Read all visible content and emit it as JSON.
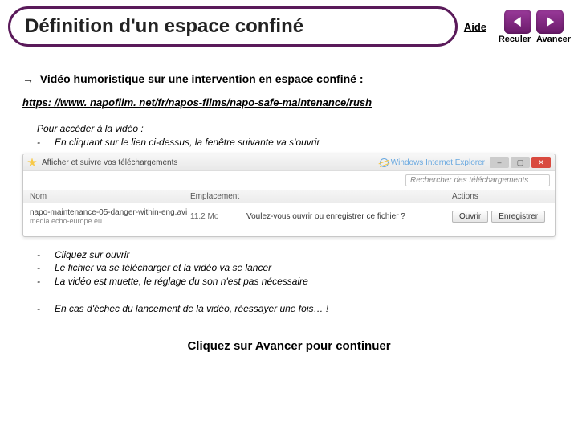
{
  "header": {
    "title": "Définition d'un espace confiné",
    "help": "Aide",
    "back": "Reculer",
    "forward": "Avancer"
  },
  "subtitle": "Vidéo humoristique sur une intervention en espace confiné :",
  "link": "https: //www. napofilm. net/fr/napos-films/napo-safe-maintenance/rush",
  "intro": "Pour accéder à la vidéo :",
  "step1": "En cliquant sur le lien ci-dessus, la fenêtre suivante va s'ouvrir",
  "download": {
    "titlebar": "Afficher et suivre vos téléchargements",
    "ie": "Windows Internet Explorer",
    "search_ph": "Rechercher des téléchargements",
    "col_nom": "Nom",
    "col_emp": "Emplacement",
    "col_act": "Actions",
    "filename": "napo-maintenance-05-danger-within-eng.avi",
    "filehost": "media.echo-europe.eu",
    "size": "11.2 Mo",
    "question": "Voulez-vous ouvrir ou enregistrer ce fichier ?",
    "btn_open": "Ouvrir",
    "btn_save": "Enregistrer"
  },
  "steps2": [
    "Cliquez sur ouvrir",
    "Le fichier va se télécharger et la vidéo va se lancer",
    "La vidéo est muette, le réglage du son n'est pas nécessaire"
  ],
  "steps3": [
    "En cas d'échec du lancement de la vidéo, réessayer une fois… !"
  ],
  "footer": "Cliquez sur Avancer pour continuer"
}
